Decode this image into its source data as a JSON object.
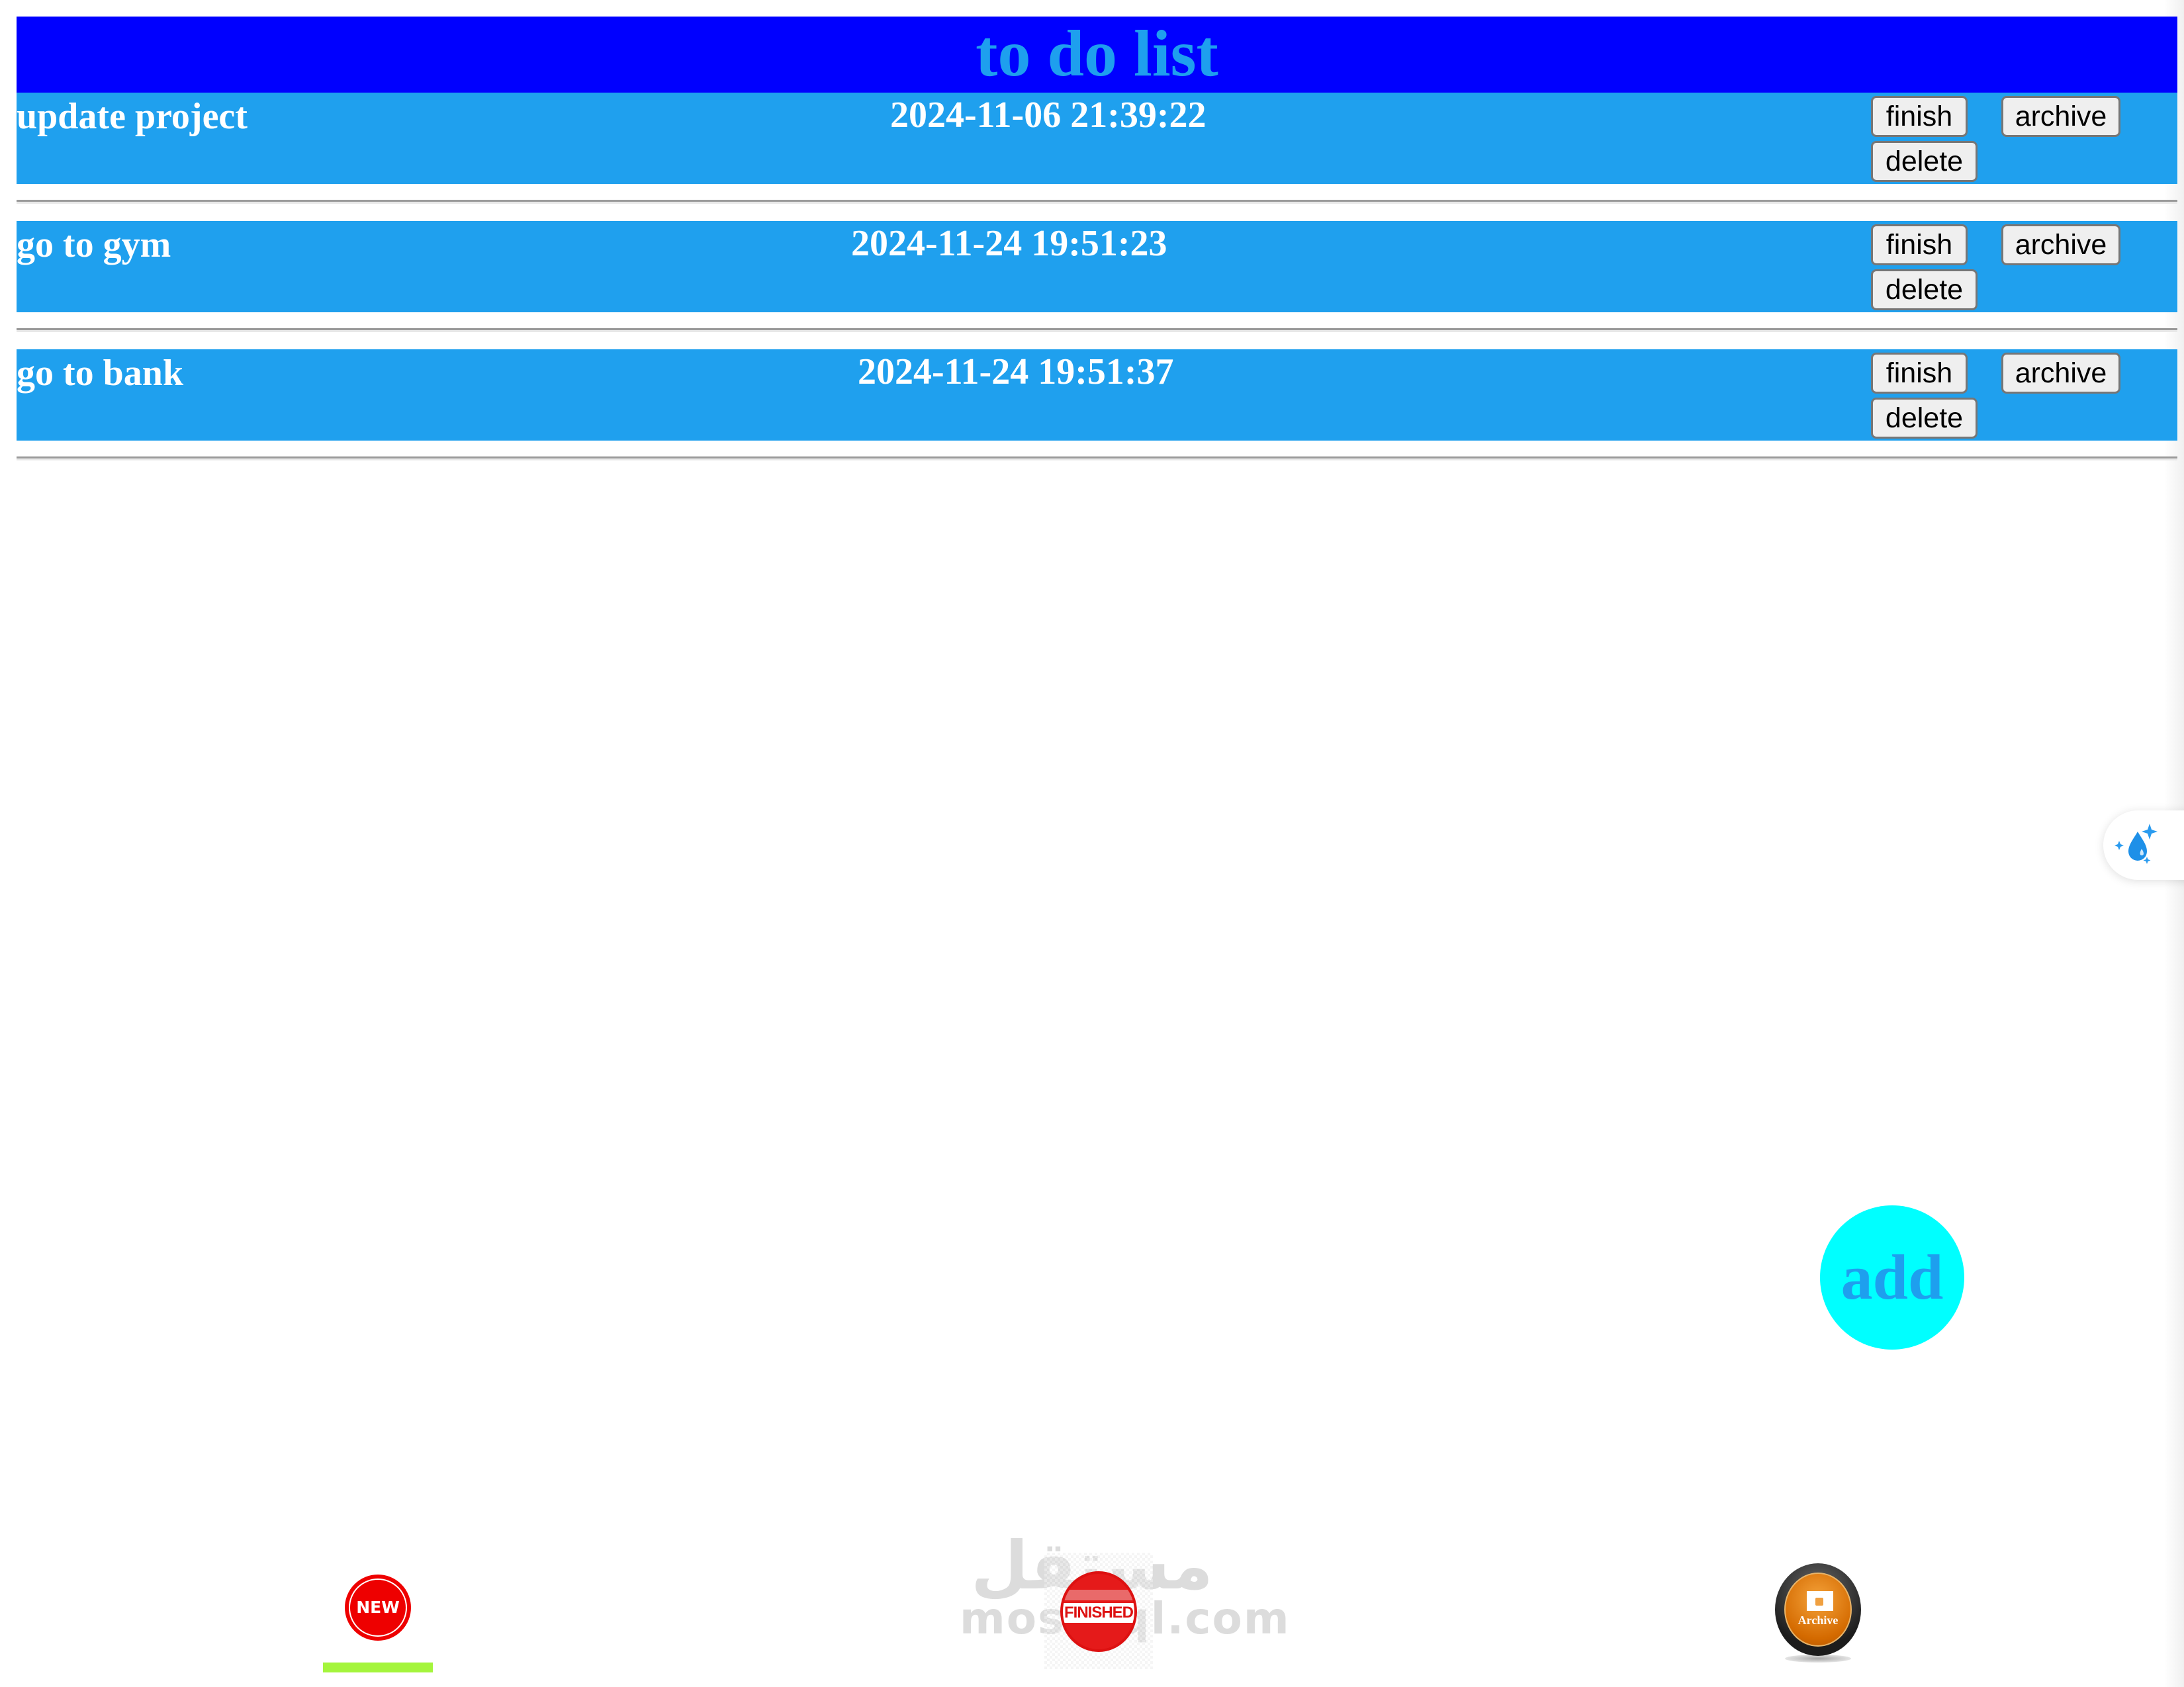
{
  "header": {
    "title": "to do list"
  },
  "tasks": [
    {
      "name": "update project",
      "timestamp": "2024-11-06 21:39:22"
    },
    {
      "name": "go to gym",
      "timestamp": "2024-11-24 19:51:23"
    },
    {
      "name": "go to bank",
      "timestamp": "2024-11-24 19:51:37"
    }
  ],
  "actions": {
    "finish": "finish",
    "archive": "archive",
    "delete": "delete"
  },
  "add_button": {
    "label": "add"
  },
  "floating_widget": {
    "icon": "water-drop-sparkle-icon"
  },
  "bottom_nav": {
    "items": [
      {
        "id": "new",
        "label": "NEW",
        "icon": "new-badge-icon",
        "active": true
      },
      {
        "id": "finished",
        "label": "FINISHED",
        "icon": "finished-stamp-icon",
        "active": false
      },
      {
        "id": "archive",
        "label": "Archive",
        "icon": "archive-lock-icon",
        "active": false
      }
    ]
  },
  "watermark": {
    "arabic": "مستقل",
    "latin": "mostaql.com"
  },
  "colors": {
    "header_bg": "#0000ff",
    "title_text": "#1e9fee",
    "row_bg": "#1fa0ee",
    "add_button_bg": "#00ffff",
    "active_indicator": "#a4f53c"
  }
}
